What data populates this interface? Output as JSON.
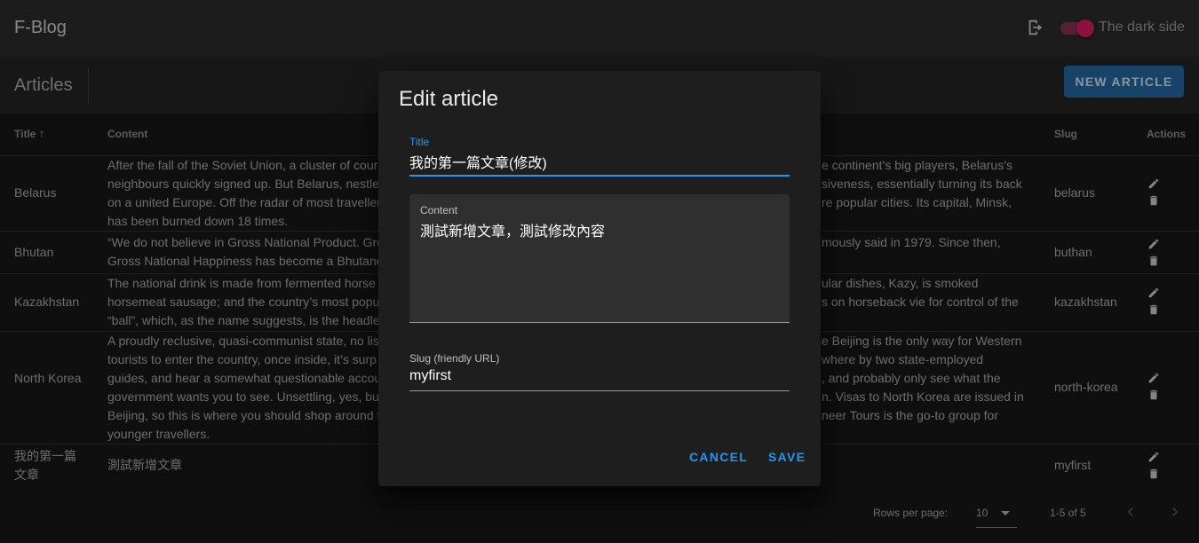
{
  "app": {
    "title": "F-Blog",
    "dark_label": "The dark side",
    "dark_on": true
  },
  "toolbar": {
    "title": "Articles",
    "new_label": "NEW ARTICLE"
  },
  "table": {
    "headers": {
      "title": "Title",
      "content": "Content",
      "slug": "Slug",
      "actions": "Actions"
    },
    "rows": [
      {
        "title": "Belarus",
        "content": [
          "After the fall of the Soviet Union, a cluster of cour",
          "neighbours quickly signed up. But Belarus, nestle",
          "on a united Europe. Off the radar of most traveller",
          "has been burned down 18 times."
        ],
        "content_right": [
          "e continent’s big players, Belarus’s",
          "siveness, essentially turning its back",
          "re popular cities. Its capital, Minsk,",
          ""
        ],
        "slug": "belarus"
      },
      {
        "title": "Bhutan",
        "content": [
          "“We do not believe in Gross National Product. Gro",
          "Gross National Happiness has become a Bhutane"
        ],
        "content_right": [
          "mously said in 1979. Since then,",
          ""
        ],
        "slug": "buthan"
      },
      {
        "title": "Kazakhstan",
        "content": [
          "The national drink is made from fermented horse",
          "horsemeat sausage; and the country’s most popu",
          "“ball”, which, as the name suggests, is the headle"
        ],
        "content_right": [
          "ular dishes, Kazy, is smoked",
          "s on horseback vie for control of the",
          ""
        ],
        "slug": "kazakhstan"
      },
      {
        "title": "North Korea",
        "content": [
          "A proudly reclusive, quasi-communist state, no lis",
          "tourists to enter the country, once inside, it’s surp",
          "guides, and hear a somewhat questionable accou",
          "government wants you to see. Unsettling, yes, but",
          "Beijing, so this is where you should shop around f",
          "younger travellers."
        ],
        "content_right": [
          "e Beijing is the only way for Western",
          "where by two state-employed",
          ", and probably only see what the",
          "n. Visas to North Korea are issued in",
          "neer Tours is the go-to group for",
          ""
        ],
        "slug": "north-korea"
      },
      {
        "title": "我的第一篇文章",
        "content": [
          "測試新增文章"
        ],
        "content_right": [
          ""
        ],
        "slug": "myfirst"
      }
    ]
  },
  "footer": {
    "rows_per_page_label": "Rows per page:",
    "rows_per_page": "10",
    "range": "1-5 of 5"
  },
  "dialog": {
    "title": "Edit article",
    "title_label": "Title",
    "title_value": "我的第一篇文章(修改)",
    "content_label": "Content",
    "content_value": "測試新增文章，測試修改內容",
    "slug_label": "Slug (friendly URL)",
    "slug_value": "myfirst",
    "cancel_label": "CANCEL",
    "save_label": "SAVE"
  },
  "colors": {
    "accent": "#2196f3",
    "switch": "#c2185b",
    "button": "#215d91"
  }
}
